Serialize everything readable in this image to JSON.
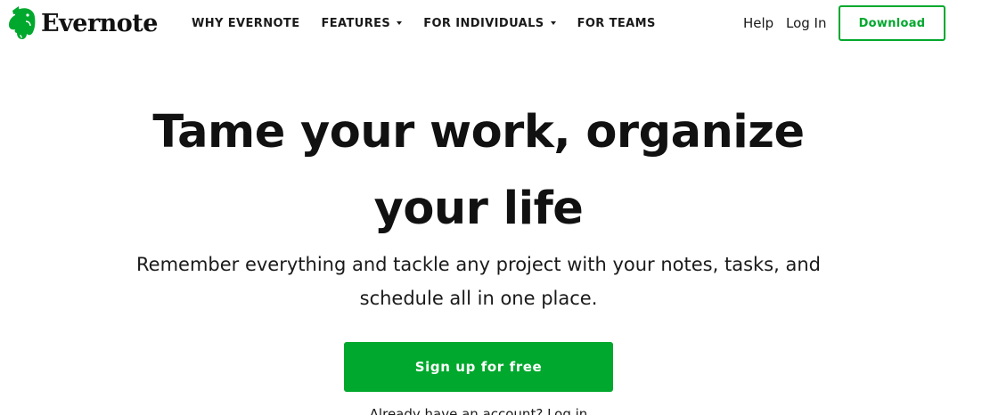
{
  "header": {
    "logo_text": "Evernote",
    "logo_icon": "elephant-icon",
    "nav": [
      {
        "label": "WHY EVERNOTE",
        "has_dropdown": false
      },
      {
        "label": "FEATURES",
        "has_dropdown": true
      },
      {
        "label": "FOR INDIVIDUALS",
        "has_dropdown": true
      },
      {
        "label": "FOR TEAMS",
        "has_dropdown": false
      }
    ],
    "help_label": "Help",
    "login_label": "Log In",
    "download_label": "Download"
  },
  "hero": {
    "title": "Tame your work, organize your life",
    "subtitle": "Remember everything and tackle any project with your notes, tasks, and schedule all in one place.",
    "cta_label": "Sign up for free",
    "signin_prompt": "Already have an account?",
    "signin_label": "Log in"
  },
  "colors": {
    "brand_green": "#00a82d",
    "text": "#1a1a1a",
    "background": "#ffffff"
  }
}
